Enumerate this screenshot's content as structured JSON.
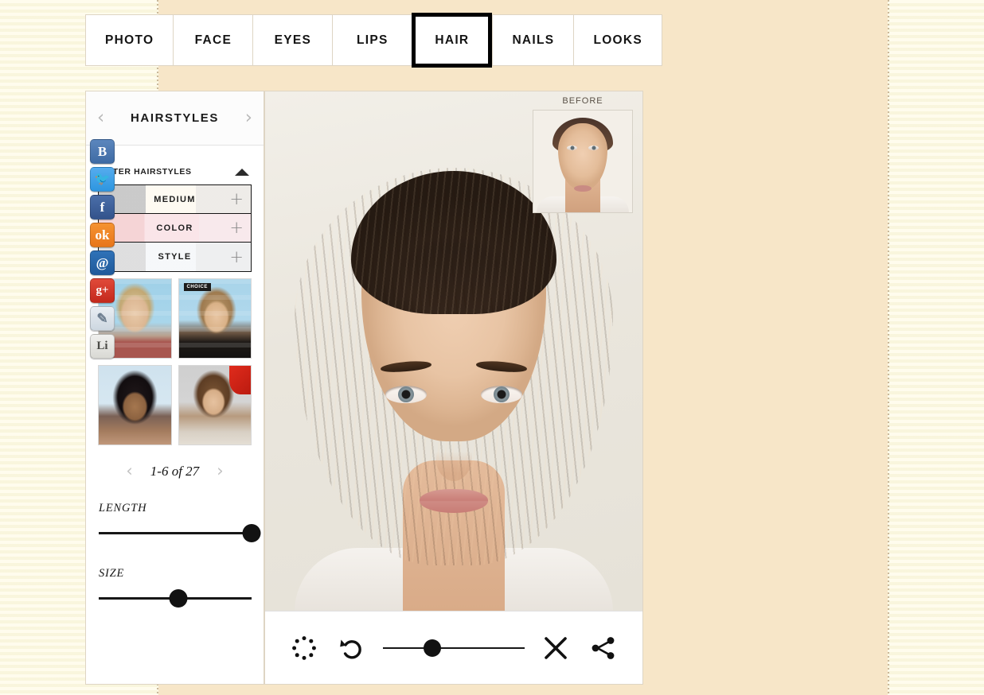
{
  "app": {
    "accent_color": "#f7e6c8",
    "panel_bg": "#ffffff",
    "active_tab_border": "#000000"
  },
  "tabs": [
    {
      "label": "PHOTO",
      "active": false
    },
    {
      "label": "FACE",
      "active": false
    },
    {
      "label": "EYES",
      "active": false
    },
    {
      "label": "LIPS",
      "active": false
    },
    {
      "label": "HAIR",
      "active": true
    },
    {
      "label": "NAILS",
      "active": false
    },
    {
      "label": "LOOKS",
      "active": false
    }
  ],
  "social": [
    {
      "name": "vkontakte",
      "glyph": "B"
    },
    {
      "name": "twitter",
      "glyph": "🐦"
    },
    {
      "name": "facebook",
      "glyph": "f"
    },
    {
      "name": "odnoklassniki",
      "glyph": "ok"
    },
    {
      "name": "mailru",
      "glyph": "@"
    },
    {
      "name": "googleplus",
      "glyph": "g+"
    },
    {
      "name": "livejournal",
      "glyph": "✎"
    },
    {
      "name": "liveinternet",
      "glyph": "Li"
    }
  ],
  "panel": {
    "title": "HAIRSTYLES",
    "prev_arrow": "‹",
    "next_arrow": "›",
    "filter": {
      "label": "FILTER HAIRSTYLES",
      "expanded": true,
      "rows": [
        {
          "label": "MEDIUM",
          "plus": "+"
        },
        {
          "label": "COLOR",
          "plus": "+"
        },
        {
          "label": "STYLE",
          "plus": "+"
        }
      ]
    },
    "thumbnails": [
      {
        "name": "hairstyle-thumb-1"
      },
      {
        "name": "hairstyle-thumb-2"
      },
      {
        "name": "hairstyle-thumb-3"
      },
      {
        "name": "hairstyle-thumb-4"
      }
    ],
    "pagination": {
      "label": "1-6 of 27",
      "prev_arrow": "‹",
      "next_arrow": "›"
    },
    "sliders": [
      {
        "label": "LENGTH",
        "value": 100
      },
      {
        "label": "SIZE",
        "value": 52
      }
    ]
  },
  "viewer": {
    "before_label": "BEFORE"
  },
  "toolbar": {
    "icons": [
      {
        "name": "compare-dotted-circle-icon"
      },
      {
        "name": "undo-icon"
      },
      {
        "name": "close-icon"
      },
      {
        "name": "share-icon"
      }
    ],
    "intensity_slider": {
      "value": 35
    }
  }
}
